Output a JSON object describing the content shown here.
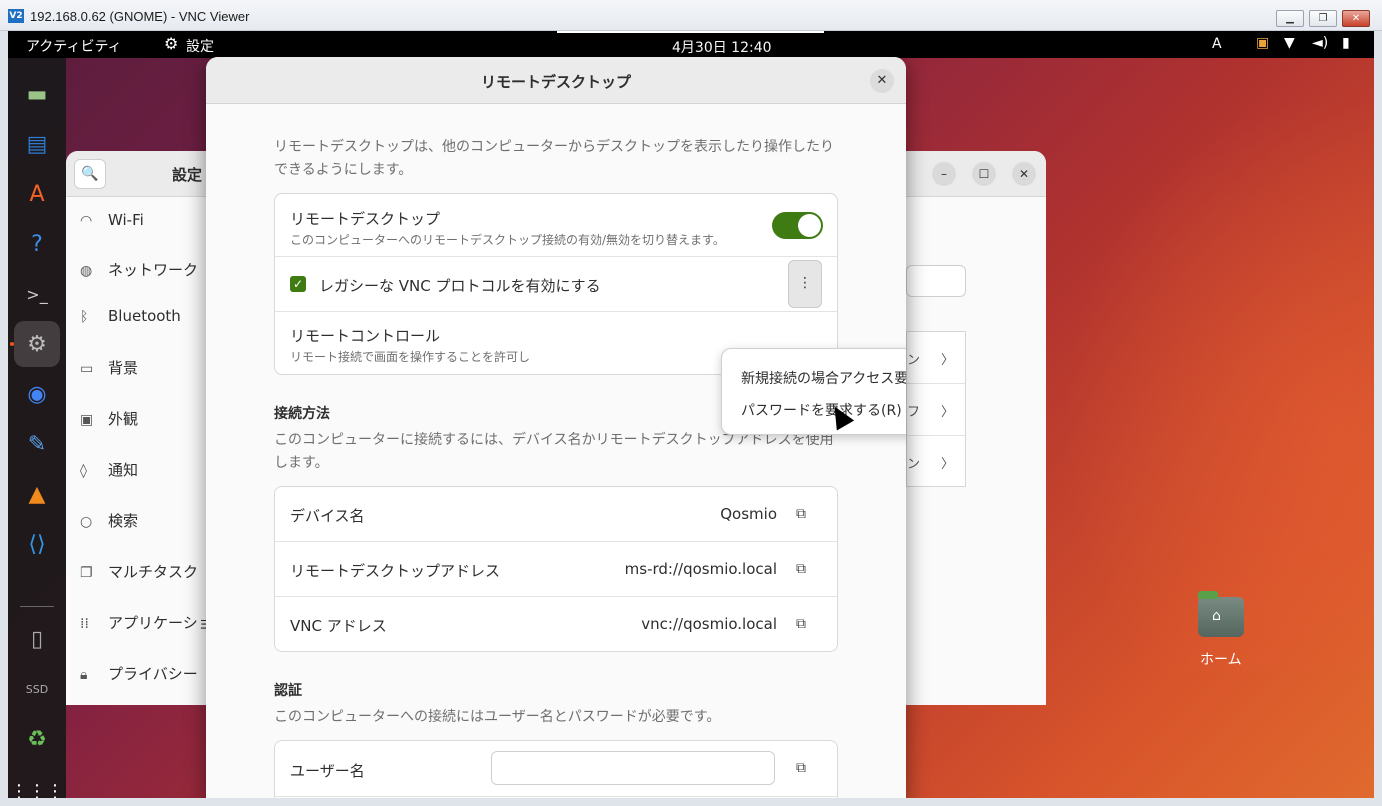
{
  "vnc": {
    "title": "192.168.0.62 (GNOME) - VNC Viewer",
    "logo": "V2"
  },
  "topbar": {
    "activities": "アクティビティ",
    "app_name": "設定",
    "clock": "4月30日  12:40",
    "ime": "A"
  },
  "dock": {
    "items": [
      "files-icon",
      "writer-icon",
      "app-store-icon",
      "help-icon",
      "terminal-icon",
      "settings-icon",
      "chrome-icon",
      "text-editor-icon",
      "vlc-icon",
      "vscode-icon",
      "disk-icon",
      "ssd-icon",
      "trash-icon",
      "app-grid-icon"
    ],
    "ssd_label": "SSD"
  },
  "settings": {
    "title": "設定",
    "sidebar": [
      {
        "label": "Wi-Fi",
        "icon": "wifi-icon"
      },
      {
        "label": "ネットワーク",
        "icon": "network-icon"
      },
      {
        "label": "Bluetooth",
        "icon": "bluetooth-icon"
      },
      {
        "label": "背景",
        "icon": "background-icon"
      },
      {
        "label": "外観",
        "icon": "appearance-icon"
      },
      {
        "label": "通知",
        "icon": "bell-icon"
      },
      {
        "label": "検索",
        "icon": "search-icon"
      },
      {
        "label": "マルチタスク",
        "icon": "multitasking-icon"
      },
      {
        "label": "アプリケーショ",
        "icon": "apps-icon"
      },
      {
        "label": "プライバシー",
        "icon": "lock-icon"
      }
    ],
    "right_rows": [
      "ン",
      "フ",
      "ン"
    ]
  },
  "desktop": {
    "home_label": "ホーム"
  },
  "dialog": {
    "title": "リモートデスクトップ",
    "intro": "リモートデスクトップは、他のコンピューターからデスクトップを表示したり操作したりできるようにします。",
    "remote_desktop": {
      "label": "リモートデスクトップ",
      "sub": "このコンピューターへのリモートデスクトップ接続の有効/無効を切り替えます。",
      "enabled": true
    },
    "legacy_vnc": {
      "label": "レガシーな VNC プロトコルを有効にする",
      "checked": true
    },
    "remote_control": {
      "label": "リモートコントロール",
      "sub": "リモート接続で画面を操作することを許可し"
    },
    "connection": {
      "title": "接続方法",
      "desc": "このコンピューターに接続するには、デバイス名かリモートデスクトップアドレスを使用します。",
      "rows": [
        {
          "label": "デバイス名",
          "value": "Qosmio"
        },
        {
          "label": "リモートデスクトップアドレス",
          "value": "ms-rd://qosmio.local"
        },
        {
          "label": "VNC アドレス",
          "value": "vnc://qosmio.local"
        }
      ]
    },
    "auth": {
      "title": "認証",
      "desc": "このコンピューターへの接続にはユーザー名とパスワードが必要です。",
      "username_label": "ユーザー名",
      "username_value": ""
    }
  },
  "popover": {
    "items": [
      {
        "label": "新規接続の場合アクセス要求を必要とする(N)",
        "selected": false
      },
      {
        "label": "パスワードを要求する(R)",
        "selected": true
      }
    ]
  },
  "colors": {
    "accent": "#3e7b12",
    "ubuntu_orange": "#e95420"
  }
}
